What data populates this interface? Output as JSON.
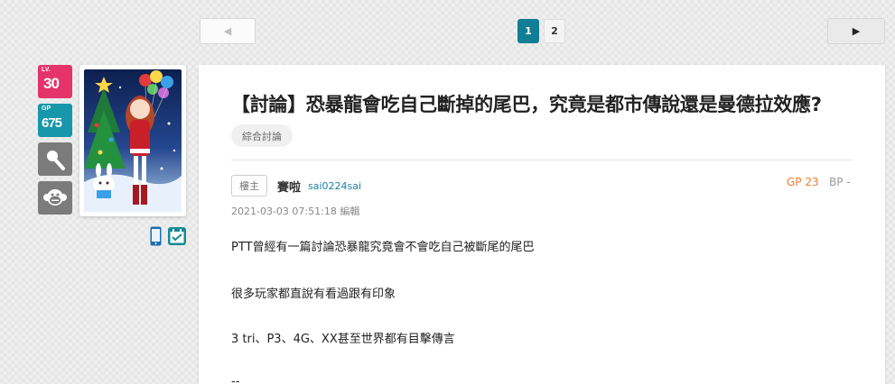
{
  "pager": {
    "prev_label": "◀",
    "next_label": "▶",
    "pages": [
      "1",
      "2"
    ],
    "current_page": "1"
  },
  "user": {
    "level_label": "LV.",
    "level_value": "30",
    "gp_label": "GP",
    "gp_value": "675",
    "icons": [
      "wand-icon",
      "monkey-icon",
      "mobile-icon",
      "calendar-icon"
    ]
  },
  "post": {
    "title": "【討論】恐暴龍會吃自己斷掉的尾巴，究竟是都市傳說還是曼德拉效應?",
    "tag": "綜合討論",
    "floor_label": "樓主",
    "author_name": "賽啦",
    "author_id": "sai0224sai",
    "gp_text": "GP 23",
    "bp_text": "BP -",
    "timestamp": "2021-03-03 07:51:18 編輯",
    "lines": [
      "PTT曾經有一篇討論恐暴龍究竟會不會吃自己被斷尾的尾巴",
      "很多玩家都直說有看過跟有印象",
      "3 tri、P3、4G、XX甚至世界都有目擊傳言",
      "--"
    ]
  },
  "colors": {
    "accent": "#117e96",
    "level_badge": "#e5336b",
    "gp_badge": "#1797a9",
    "gp_text": "#f07a2c",
    "author_id": "#1a7fa8"
  }
}
